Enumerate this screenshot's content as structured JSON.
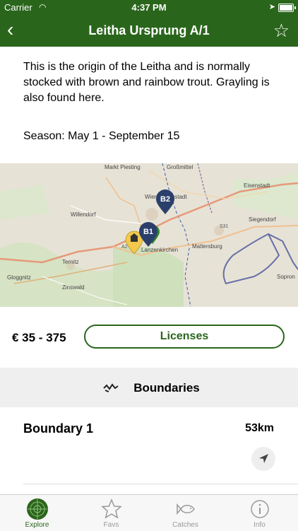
{
  "status_bar": {
    "carrier": "Carrier",
    "time": "4:37 PM"
  },
  "header": {
    "back_label": "‹",
    "title": "Leitha Ursprung A/1",
    "favorite_label": "☆"
  },
  "description": "This is the origin of the Leitha and is normally stocked with brown and rainbow trout. Grayling is also found here.",
  "season": "Season: May 1 - September 15",
  "map": {
    "place_labels": [
      "Markt Piesting",
      "Großmittel",
      "Eisenstadt",
      "Wiener Neustadt",
      "Willendorf",
      "Siegendorf",
      "S31",
      "A2",
      "Mattersburg",
      "Lanzenkirchen",
      "Ternitz",
      "Gloggnitz",
      "Zinswald",
      "Sopron"
    ],
    "markers": [
      "B2",
      "B1"
    ]
  },
  "pricing": {
    "price": "€ 35 - 375",
    "licenses_label": "Licenses"
  },
  "boundaries": {
    "heading": "Boundaries",
    "items": [
      {
        "name": "Boundary 1",
        "distance": "53km"
      }
    ]
  },
  "tabbar": {
    "tabs": [
      {
        "label": "Explore",
        "icon": "radar-icon"
      },
      {
        "label": "Favs",
        "icon": "star-icon"
      },
      {
        "label": "Catches",
        "icon": "fish-icon"
      },
      {
        "label": "Info",
        "icon": "info-icon"
      }
    ]
  },
  "colors": {
    "brand_green": "#2a651c",
    "marker_blue": "#2b3f6b",
    "marker_yellow": "#f2c94c"
  }
}
